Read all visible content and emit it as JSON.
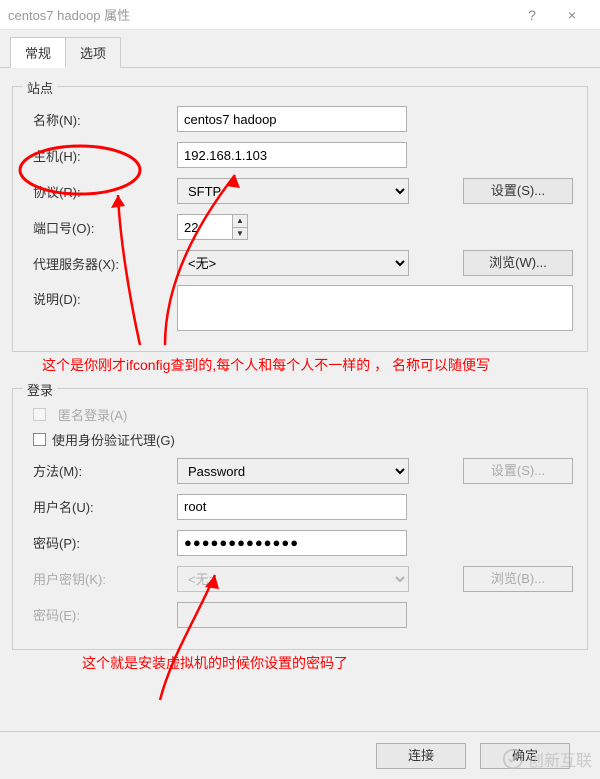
{
  "window": {
    "title": "centos7 hadoop 属性",
    "help": "?",
    "close": "×"
  },
  "tabs": {
    "general": "常规",
    "options": "选项"
  },
  "site": {
    "legend": "站点",
    "name_label": "名称(N):",
    "name_value": "centos7 hadoop",
    "host_label": "主机(H):",
    "host_value": "192.168.1.103",
    "protocol_label": "协议(R):",
    "protocol_value": "SFTP",
    "protocol_btn": "设置(S)...",
    "port_label": "端口号(O):",
    "port_value": "22",
    "proxy_label": "代理服务器(X):",
    "proxy_value": "<无>",
    "proxy_btn": "浏览(W)...",
    "desc_label": "说明(D):",
    "desc_value": ""
  },
  "login": {
    "legend": "登录",
    "anon_label": "匿名登录(A)",
    "useproxy_label": "使用身份验证代理(G)",
    "method_label": "方法(M):",
    "method_value": "Password",
    "method_btn": "设置(S)...",
    "user_label": "用户名(U):",
    "user_value": "root",
    "pass_label": "密码(P):",
    "pass_value": "●●●●●●●●●●●●●",
    "userkey_label": "用户密钥(K):",
    "userkey_value": "<无>",
    "userkey_btn": "浏览(B)...",
    "passphrase_label": "密码(E):"
  },
  "annotations": {
    "a1": "这个是你刚才ifconfig查到的,每个人和每个人不一样的 ， 名称可以随便写",
    "a2": "这个就是安装虚拟机的时候你设置的密码了"
  },
  "buttons": {
    "connect": "连接",
    "ok": "确定"
  },
  "watermark": "创新互联"
}
